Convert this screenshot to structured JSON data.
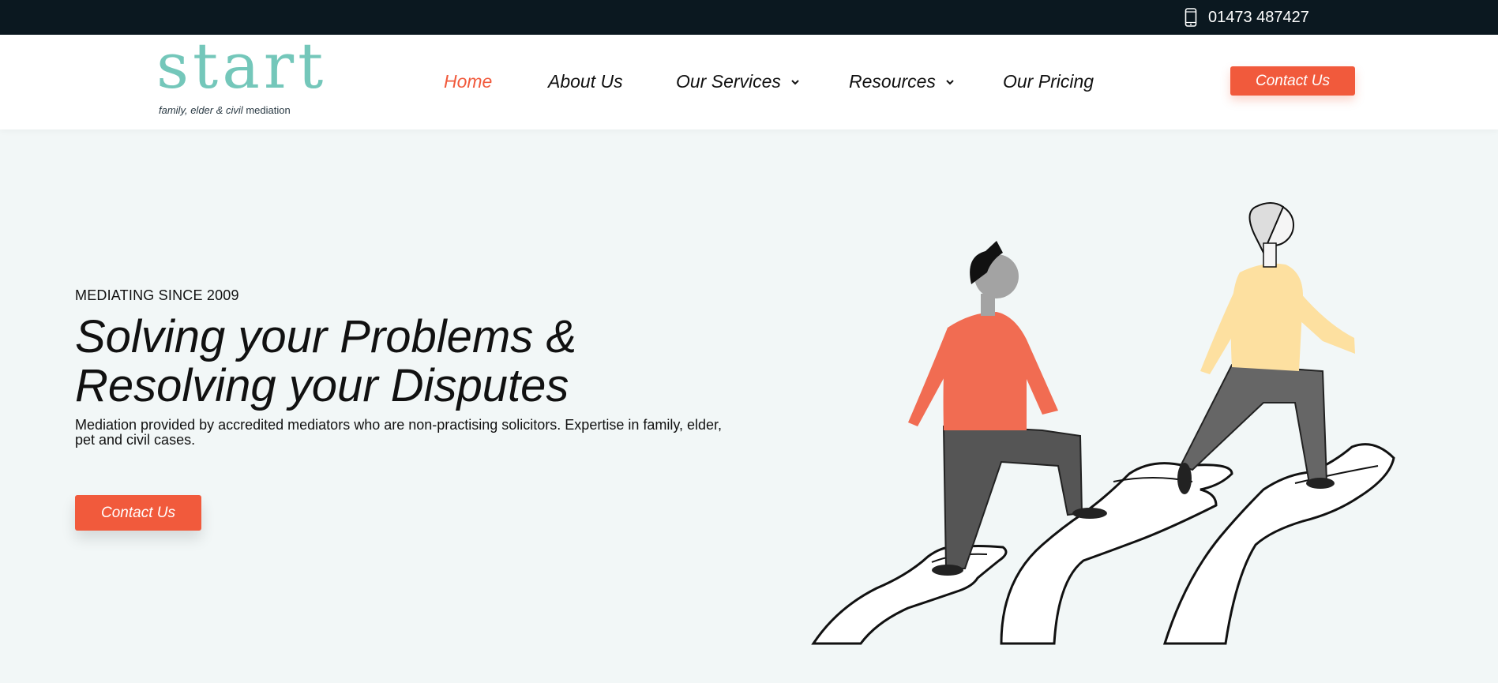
{
  "topbar": {
    "phone_icon": "mobile-phone-icon",
    "phone": "01473 487427"
  },
  "brand": {
    "logo_word": "start",
    "tagline_italic": "family, elder & civil",
    "tagline_plain": "mediation",
    "logo_color": "#74c7ba"
  },
  "nav": {
    "items": [
      {
        "label": "Home",
        "active": true
      },
      {
        "label": "About Us"
      },
      {
        "label": "Our Services",
        "icon": "chevron-down-icon"
      },
      {
        "label": "Resources",
        "icon": "chevron-down-icon"
      },
      {
        "label": "Our Pricing"
      }
    ],
    "cta": "Contact Us"
  },
  "hero": {
    "eyebrow": "MEDIATING SINCE 2009",
    "title_line1": "Solving your Problems &",
    "title_line2": "Resolving your Disputes",
    "description": "Mediation provided by accredited mediators who are non-practising solicitors. Expertise in family, elder, pet and civil cases.",
    "cta": "Contact Us",
    "illustration": "people-climbing-hands-illustration"
  },
  "colors": {
    "accent": "#f15a3c",
    "topbar_bg": "#0b1820",
    "page_bg": "#f2f7f7",
    "shirt_orange": "#f16c52",
    "shirt_yellow": "#fde0a0"
  }
}
